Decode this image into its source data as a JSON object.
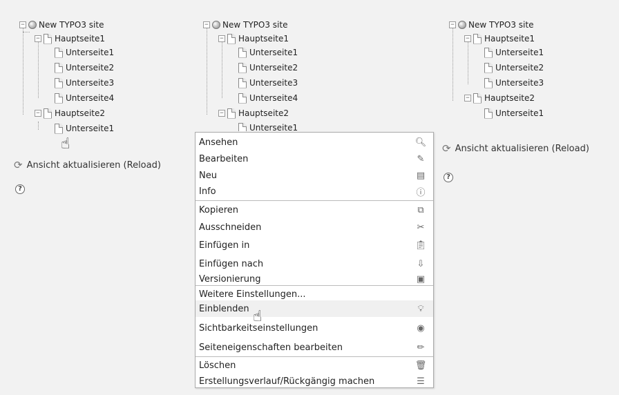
{
  "trees": [
    {
      "root": "New TYPO3 site",
      "h1": "Hauptseite1",
      "h1_children": [
        "Unterseite1",
        "Unterseite2",
        "Unterseite3",
        "Unterseite4"
      ],
      "h2": "Hauptseite2",
      "h2_children": [
        "Unterseite1"
      ]
    },
    {
      "root": "New TYPO3 site",
      "h1": "Hauptseite1",
      "h1_children": [
        "Unterseite1",
        "Unterseite2",
        "Unterseite3",
        "Unterseite4"
      ],
      "h2": "Hauptseite2",
      "h2_children": [
        "Unterseite1"
      ]
    },
    {
      "root": "New TYPO3 site",
      "h1": "Hauptseite1",
      "h1_children": [
        "Unterseite1",
        "Unterseite2",
        "Unterseite3"
      ],
      "h2": "Hauptseite2",
      "h2_children": [
        "Unterseite1"
      ]
    }
  ],
  "reload_label": "Ansicht aktualisieren (Reload)",
  "help_glyph": "?",
  "context_menu": {
    "items": [
      {
        "label": "Ansehen",
        "icon": "magnifier-icon"
      },
      {
        "label": "Bearbeiten",
        "icon": "edit-icon"
      },
      {
        "label": "Neu",
        "icon": "new-page-icon"
      },
      {
        "label": "Info",
        "icon": "info-icon"
      },
      {
        "label": "Kopieren",
        "icon": "copy-icon"
      },
      {
        "label": "Ausschneiden",
        "icon": "scissors-icon"
      },
      {
        "label": "Einfügen in",
        "icon": "paste-into-icon"
      },
      {
        "label": "Einfügen nach",
        "icon": "paste-after-icon"
      },
      {
        "label": "Versionierung",
        "icon": "versioning-icon"
      },
      {
        "label": "Weitere Einstellungen...",
        "icon": ""
      },
      {
        "label": "Einblenden",
        "icon": "lightbulb-icon"
      },
      {
        "label": "Sichtbarkeitseinstellungen",
        "icon": "visibility-icon"
      },
      {
        "label": "Seiteneigenschaften bearbeiten",
        "icon": "pencil-icon"
      },
      {
        "label": "Löschen",
        "icon": "trash-icon"
      },
      {
        "label": "Erstellungsverlauf/Rückgängig machen",
        "icon": "history-icon"
      }
    ]
  }
}
